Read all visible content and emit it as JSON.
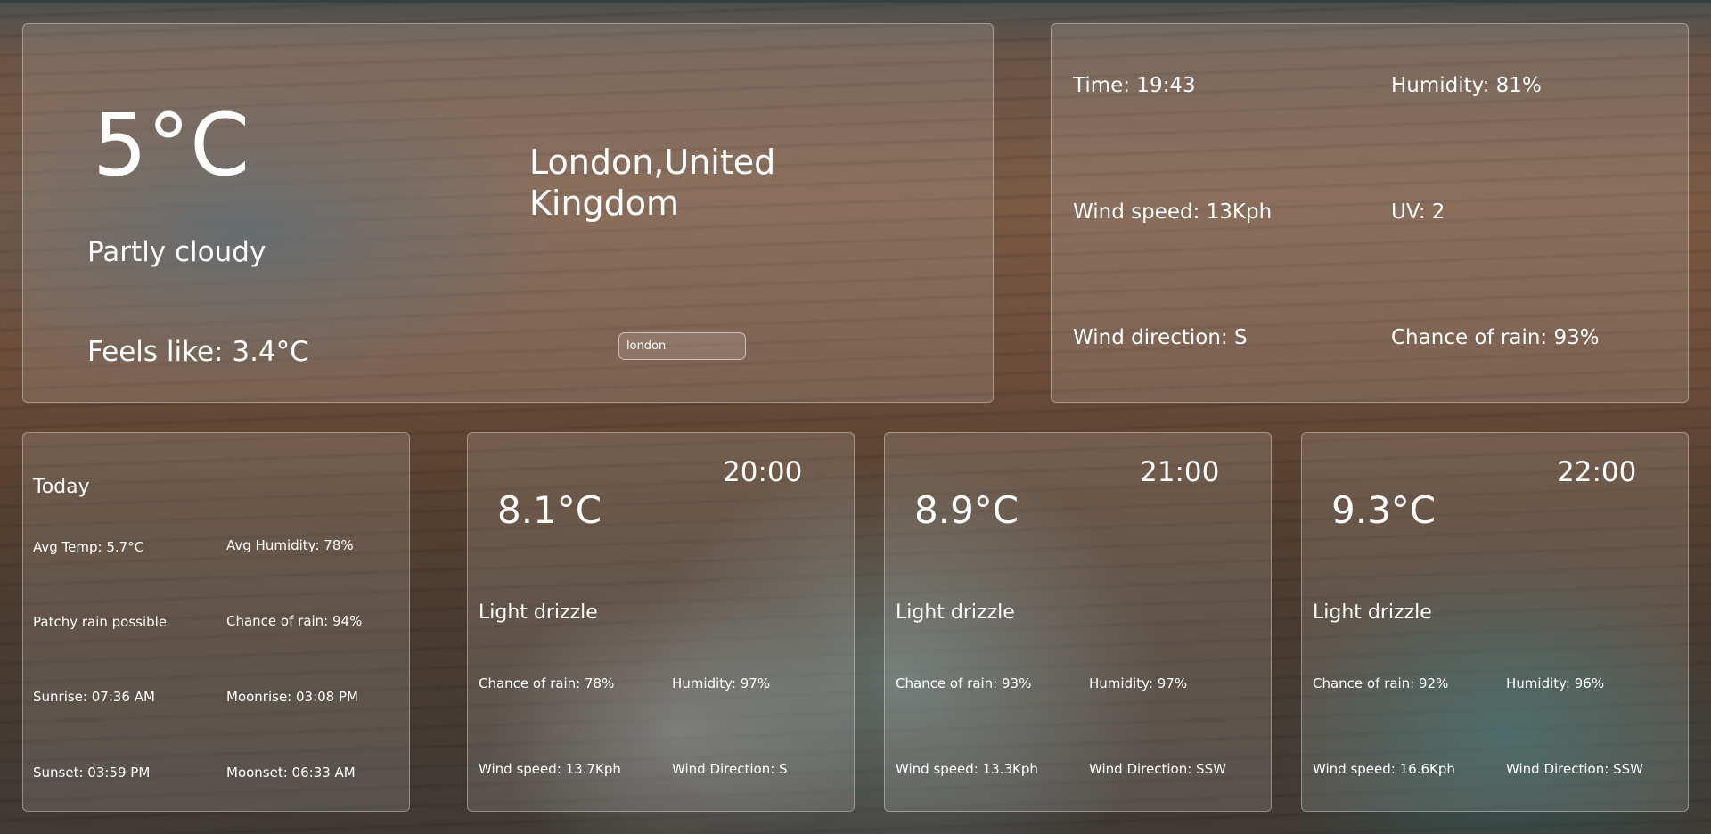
{
  "current": {
    "temp": "5°C",
    "condition": "Partly cloudy",
    "feels_like": "Feels like: 3.4°C",
    "location": "London,United Kingdom",
    "search_value": "london"
  },
  "details": {
    "time": "Time: 19:43",
    "humidity": "Humidity: 81%",
    "wind_speed": "Wind speed: 13Kph",
    "uv": "UV: 2",
    "wind_direction": "Wind direction: S",
    "chance_of_rain": "Chance of rain: 93%"
  },
  "today": {
    "title": "Today",
    "avg_temp": "Avg Temp: 5.7°C",
    "avg_humidity": "Avg Humidity: 78%",
    "condition": "Patchy rain possible",
    "chance_of_rain": "Chance of rain: 94%",
    "sunrise": "Sunrise: 07:36 AM",
    "moonrise": "Moonrise: 03:08 PM",
    "sunset": "Sunset: 03:59 PM",
    "moonset": "Moonset: 06:33 AM"
  },
  "hourly": [
    {
      "time": "20:00",
      "temp": "8.1°C",
      "condition": "Light drizzle",
      "chance_of_rain": "Chance of rain: 78%",
      "humidity": "Humidity: 97%",
      "wind_speed": "Wind speed: 13.7Kph",
      "wind_direction": "Wind Direction: S"
    },
    {
      "time": "21:00",
      "temp": "8.9°C",
      "condition": "Light drizzle",
      "chance_of_rain": "Chance of rain: 93%",
      "humidity": "Humidity: 97%",
      "wind_speed": "Wind speed: 13.3Kph",
      "wind_direction": "Wind Direction: SSW"
    },
    {
      "time": "22:00",
      "temp": "9.3°C",
      "condition": "Light drizzle",
      "chance_of_rain": "Chance of rain: 92%",
      "humidity": "Humidity: 96%",
      "wind_speed": "Wind speed: 16.6Kph",
      "wind_direction": "Wind Direction: SSW"
    }
  ]
}
